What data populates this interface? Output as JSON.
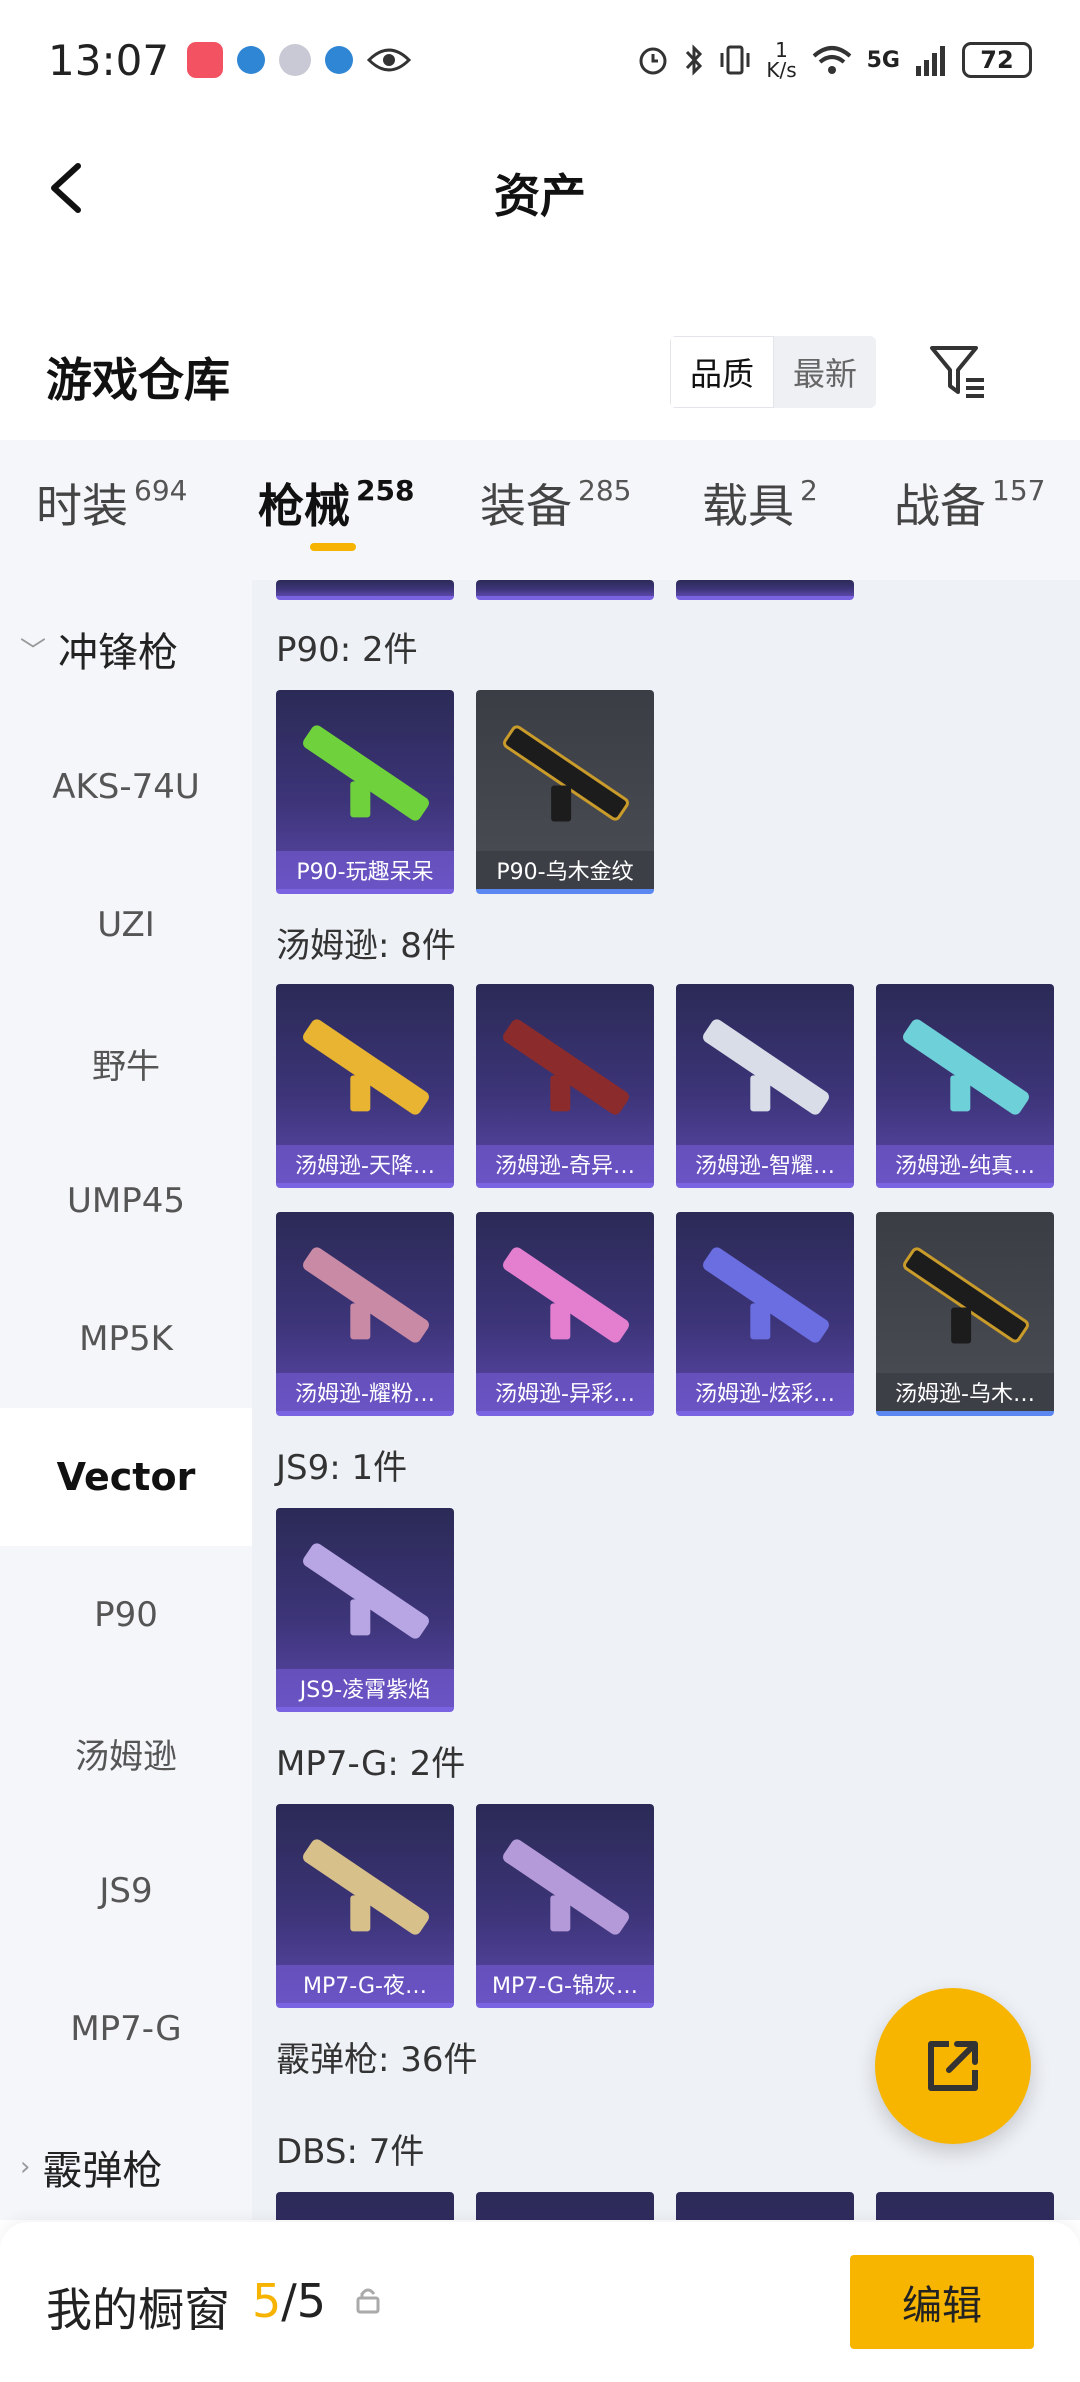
{
  "status_bar": {
    "time": "13:07",
    "speed_num": "1",
    "speed_unit": "K/s",
    "network": "5G",
    "battery": "72"
  },
  "header": {
    "title": "资产"
  },
  "warehouse": {
    "title": "游戏仓库",
    "sort_quality": "品质",
    "sort_latest": "最新"
  },
  "tabs": [
    {
      "label": "时装",
      "count": "694"
    },
    {
      "label": "枪械",
      "count": "258",
      "active": true
    },
    {
      "label": "装备",
      "count": "285"
    },
    {
      "label": "载具",
      "count": "2"
    },
    {
      "label": "战备",
      "count": "157"
    }
  ],
  "sidebar": {
    "items": [
      {
        "label": "冲锋枪",
        "type": "group"
      },
      {
        "label": "AKS-74U"
      },
      {
        "label": "UZI"
      },
      {
        "label": "野牛"
      },
      {
        "label": "UMP45"
      },
      {
        "label": "MP5K"
      },
      {
        "label": "Vector",
        "active": true
      },
      {
        "label": "P90"
      },
      {
        "label": "汤姆逊"
      },
      {
        "label": "JS9"
      },
      {
        "label": "MP7-G"
      },
      {
        "label": "霰弹枪",
        "type": "group"
      }
    ]
  },
  "content": {
    "sections": [
      {
        "label": "P90: 2件",
        "items": [
          "P90-玩趣呆呆",
          "P90-乌木金纹"
        ]
      },
      {
        "label": "汤姆逊: 8件",
        "items": [
          "汤姆逊-天降…",
          "汤姆逊-奇异…",
          "汤姆逊-智耀…",
          "汤姆逊-纯真…",
          "汤姆逊-耀粉…",
          "汤姆逊-异彩…",
          "汤姆逊-炫彩…",
          "汤姆逊-乌木…"
        ]
      },
      {
        "label": "JS9: 1件",
        "items": [
          "JS9-凌霄紫焰"
        ]
      },
      {
        "label": "MP7-G: 2件",
        "items": [
          "MP7-G-夜…",
          "MP7-G-锦灰…"
        ]
      },
      {
        "label": "霰弹枪: 36件"
      },
      {
        "label": "DBS: 7件"
      }
    ]
  },
  "bottom_bar": {
    "showcase_label": "我的橱窗",
    "showcase_current": "5",
    "showcase_sep": "/",
    "showcase_total": "5",
    "edit_label": "编辑"
  },
  "colors": {
    "accent": "#f7b500",
    "card_purple": "#3c3478",
    "card_grey": "#4b4d55"
  }
}
